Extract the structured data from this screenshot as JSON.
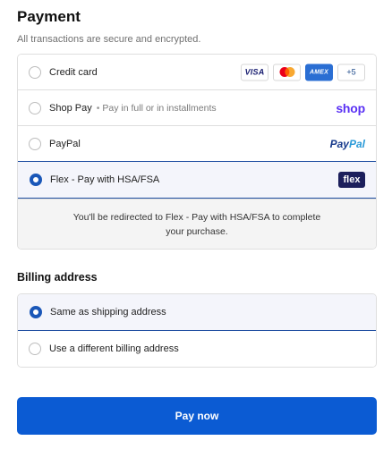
{
  "payment": {
    "title": "Payment",
    "subtitle": "All transactions are secure and encrypted.",
    "options": [
      {
        "label": "Credit card",
        "sublabel": "",
        "selected": false
      },
      {
        "label": "Shop Pay",
        "sublabel": "Pay in full or in installments",
        "selected": false
      },
      {
        "label": "PayPal",
        "sublabel": "",
        "selected": false
      },
      {
        "label": "Flex - Pay with HSA/FSA",
        "sublabel": "",
        "selected": true
      }
    ],
    "card_badges": {
      "visa": "VISA",
      "amex": "AMEX",
      "more": "+5"
    },
    "logos": {
      "shop": "shop",
      "paypal_part1": "Pay",
      "paypal_part2": "Pal",
      "flex": "flex"
    },
    "redirect_message": "You'll be redirected to Flex - Pay with HSA/FSA to complete your purchase."
  },
  "billing": {
    "title": "Billing address",
    "options": [
      {
        "label": "Same as shipping address",
        "selected": true
      },
      {
        "label": "Use a different billing address",
        "selected": false
      }
    ]
  },
  "pay_button": {
    "label": "Pay now"
  },
  "colors": {
    "accent": "#1a57b8",
    "button": "#0b5bd3",
    "shop_purple": "#5a31f4",
    "flex_navy": "#1c1f5c"
  }
}
